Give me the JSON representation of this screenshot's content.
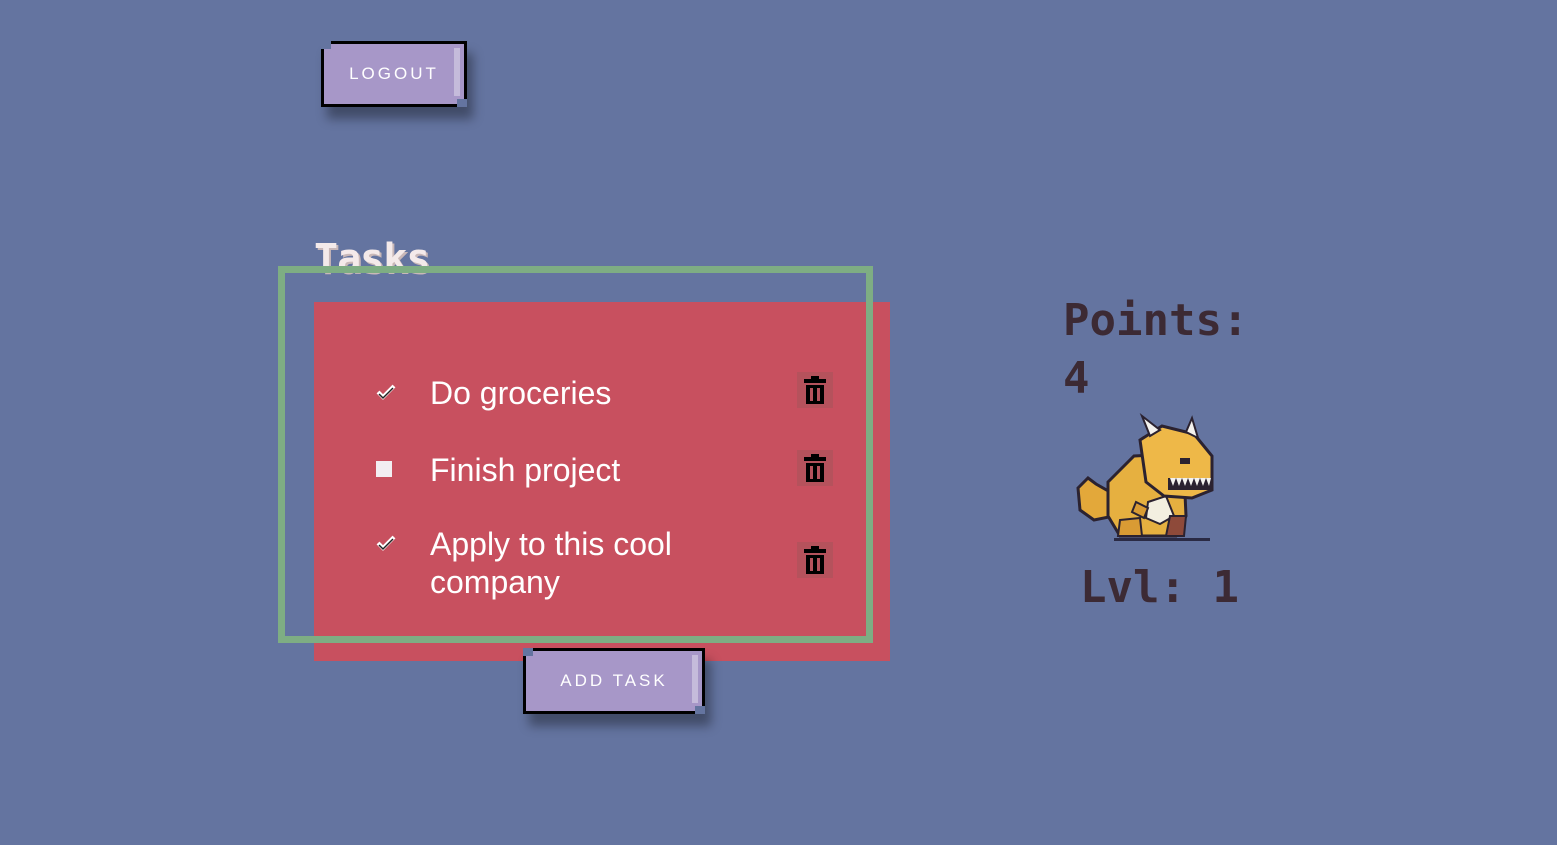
{
  "header": {
    "logout_label": "Logout"
  },
  "tasks": {
    "title": "Tasks",
    "items": [
      {
        "label": "Do groceries",
        "checked": true
      },
      {
        "label": "Finish project",
        "checked": false
      },
      {
        "label": "Apply to this cool company",
        "checked": true
      }
    ],
    "add_label": "Add Task"
  },
  "stats": {
    "points_label": "Points:",
    "points_value": "4",
    "level_text": "Lvl: 1"
  },
  "colors": {
    "background": "#6474a0",
    "panel": "#c8505f",
    "frame": "#7ead83",
    "button": "#a797c8",
    "stat_text": "#3c2a34"
  },
  "icons": {
    "delete": "trash-icon",
    "done": "checkmark-icon",
    "pet": "dinosaur-pet"
  }
}
